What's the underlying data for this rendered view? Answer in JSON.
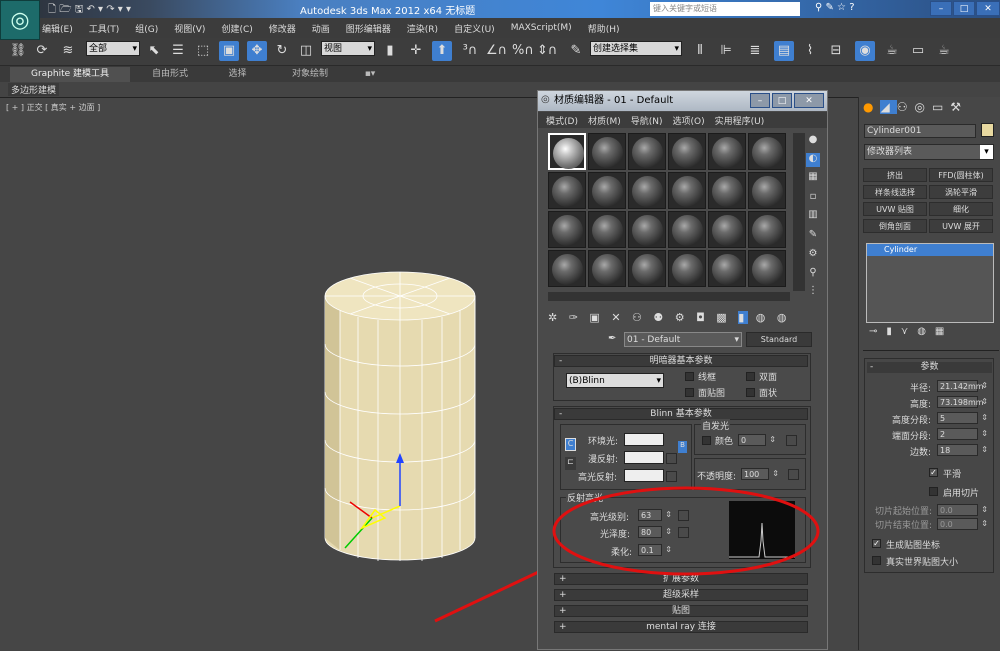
{
  "app": {
    "title": "Autodesk 3ds Max  2012 x64     无标题",
    "search_placeholder": "键入关键字或短语",
    "logo": "3ds-max-logo"
  },
  "menu": [
    "编辑(E)",
    "工具(T)",
    "组(G)",
    "视图(V)",
    "创建(C)",
    "修改器",
    "动画",
    "图形编辑器",
    "渲染(R)",
    "自定义(U)",
    "MAXScript(M)",
    "帮助(H)"
  ],
  "toolbar": {
    "selection_filter": "全部",
    "ref_coord": "视图",
    "named_selection": "创建选择集"
  },
  "ribbon": {
    "tabs": [
      "Graphite 建模工具",
      "自由形式",
      "选择",
      "对象绘制"
    ],
    "subtab": "多边形建模"
  },
  "viewport": {
    "label": "[ + ] 正交 [ 真实 + 边面 ]",
    "object_color": "#e8dcb0"
  },
  "material_editor": {
    "title": "材质编辑器 - 01 - Default",
    "menu": [
      "模式(D)",
      "材质(M)",
      "导航(N)",
      "选项(O)",
      "实用程序(U)"
    ],
    "material_name": "01 - Default",
    "material_type": "Standard",
    "shader_rollout": {
      "title": "明暗器基本参数",
      "shader": "(B)Blinn",
      "options": [
        {
          "label": "线框",
          "checked": false
        },
        {
          "label": "双面",
          "checked": false
        },
        {
          "label": "面贴图",
          "checked": false
        },
        {
          "label": "面状",
          "checked": false
        }
      ]
    },
    "blinn_rollout": {
      "title": "Blinn 基本参数",
      "ambient": "环境光:",
      "diffuse": "漫反射:",
      "specular": "高光反射:",
      "self_illum": "自发光",
      "color_label": "颜色",
      "self_illum_value": "0",
      "opacity_label": "不透明度:",
      "opacity": "100"
    },
    "specular_highlights": {
      "title": "反射高光",
      "level_label": "高光级别:",
      "level": "63",
      "gloss_label": "光泽度:",
      "gloss": "80",
      "soften_label": "柔化:",
      "soften": "0.1"
    },
    "collapsed_rollouts": [
      "扩展参数",
      "超级采样",
      "贴图",
      "mental ray 连接"
    ]
  },
  "command_panel": {
    "object_name": "Cylinder001",
    "object_color": "#e8d9a0",
    "modifier_list": "修改器列表",
    "modifier_buttons": [
      "挤出",
      "FFD(圆柱体)",
      "样条线选择",
      "涡轮平滑",
      "UVW 贴图",
      "细化",
      "倒角剖面",
      "UVW 展开"
    ],
    "stack": [
      "Cylinder"
    ],
    "params_title": "参数",
    "params": [
      {
        "label": "半径:",
        "value": "21.142mm"
      },
      {
        "label": "高度:",
        "value": "73.198mm"
      },
      {
        "label": "高度分段:",
        "value": "5"
      },
      {
        "label": "端面分段:",
        "value": "2"
      },
      {
        "label": "边数:",
        "value": "18"
      }
    ],
    "smooth": {
      "label": "平滑",
      "checked": true
    },
    "slice_on": {
      "label": "启用切片",
      "checked": false
    },
    "slice_from": {
      "label": "切片起始位置:",
      "value": "0.0"
    },
    "slice_to": {
      "label": "切片结束位置:",
      "value": "0.0"
    },
    "gen_map": {
      "label": "生成贴图坐标",
      "checked": true
    },
    "real_world": {
      "label": "真实世界贴图大小",
      "checked": false
    }
  },
  "annotation_color": "#e01010"
}
